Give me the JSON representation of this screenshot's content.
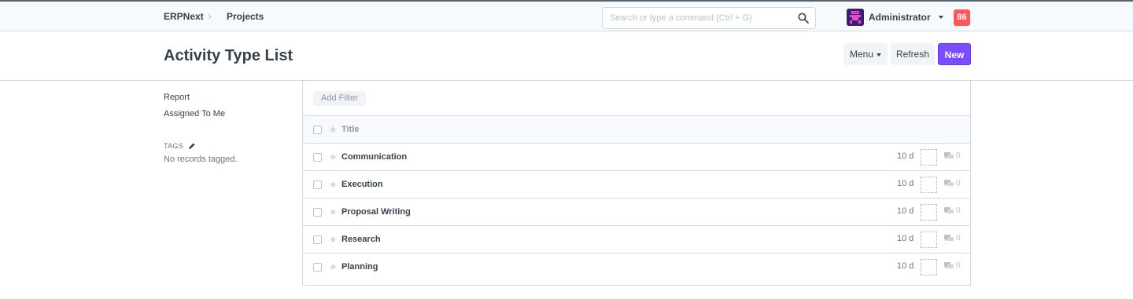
{
  "navbar": {
    "breadcrumbs": [
      "ERPNext",
      "Projects"
    ],
    "search_placeholder": "Search or type a command (Ctrl + G)",
    "user_name": "Administrator",
    "notification_count": "86"
  },
  "page": {
    "title": "Activity Type List",
    "menu_label": "Menu",
    "refresh_label": "Refresh",
    "new_label": "New"
  },
  "sidebar": {
    "items": [
      "Report",
      "Assigned To Me"
    ],
    "tags_label": "TAGS",
    "no_tags_text": "No records tagged."
  },
  "list": {
    "add_filter_label": "Add Filter",
    "column_title": "Title",
    "rows": [
      {
        "title": "Communication",
        "modified": "10 d",
        "comments": "0"
      },
      {
        "title": "Execution",
        "modified": "10 d",
        "comments": "0"
      },
      {
        "title": "Proposal Writing",
        "modified": "10 d",
        "comments": "0"
      },
      {
        "title": "Research",
        "modified": "10 d",
        "comments": "0"
      },
      {
        "title": "Planning",
        "modified": "10 d",
        "comments": "0"
      }
    ]
  },
  "colors": {
    "primary": "#7c4dff",
    "notification": "#ff5858",
    "text": "#36414c"
  }
}
